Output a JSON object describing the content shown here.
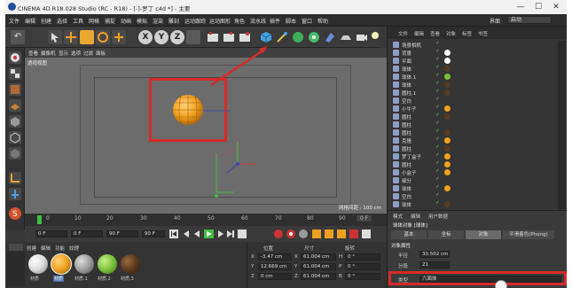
{
  "window": {
    "title": "CINEMA 4D R18.028 Studio (RC - R18) - [-]-罗丁 c4d *] - 主要",
    "controls": {
      "minimize": "—",
      "maximize": "☐",
      "close": "✕"
    }
  },
  "menubar": {
    "items": [
      "文件",
      "编辑",
      "创建",
      "选择",
      "工具",
      "网格",
      "捕捉",
      "动画",
      "模拟",
      "渲染",
      "雕刻",
      "运动跟踪",
      "运动图形",
      "角色",
      "流水线",
      "插件",
      "脚本",
      "窗口",
      "帮助"
    ],
    "layout_label": "界面",
    "layout_value": "启动"
  },
  "toolbar": {
    "axis_buttons": [
      "X",
      "Y",
      "Z"
    ]
  },
  "viewport": {
    "menu": [
      "查看",
      "摄像机",
      "显示",
      "选项",
      "过滤",
      "面板"
    ],
    "name": "透视视图",
    "grid_info": "网格间距 : 100 cm"
  },
  "timeline": {
    "ticks": [
      "0",
      "10",
      "20",
      "30",
      "40",
      "50",
      "60",
      "70",
      "80",
      "90"
    ],
    "end_label": "0 F"
  },
  "transport": {
    "current_frame": "0 F",
    "start_frame": "0 F",
    "end_frame": "90 F",
    "end_frame_2": "90 F"
  },
  "materials": {
    "menu": [
      "创建",
      "编辑",
      "功能",
      "纹理"
    ],
    "items": [
      {
        "label": "材质",
        "color": "#d9d9d9"
      },
      {
        "label": "材质",
        "color": "#f0a020"
      },
      {
        "label": "材质.1",
        "color": "#9c9c9c"
      },
      {
        "label": "材质.2",
        "color": "#7cc23a"
      },
      {
        "label": "材质.3",
        "color": "#5a3a1e"
      }
    ]
  },
  "coordinates": {
    "headers": [
      "位置",
      "尺寸",
      "旋转"
    ],
    "rows": [
      {
        "axis": "X",
        "pos": "-3.47 cm",
        "size_axis": "X",
        "size": "61.004 cm",
        "rot_axis": "H",
        "rot": "0 °"
      },
      {
        "axis": "Y",
        "pos": "12.669 cm",
        "size_axis": "Y",
        "size": "61.004 cm",
        "rot_axis": "P",
        "rot": "0 °"
      },
      {
        "axis": "Z",
        "pos": "0 cm",
        "size_axis": "Z",
        "size": "61.004 cm",
        "rot_axis": "B",
        "rot": "0 °"
      }
    ]
  },
  "object_manager": {
    "menu": [
      "文件",
      "编辑",
      "查看",
      "对象",
      "标签",
      "书签"
    ],
    "objects": [
      {
        "name": "场景相机",
        "swatch": ""
      },
      {
        "name": "背景",
        "swatch": "#ffffff"
      },
      {
        "name": "平面",
        "swatch": "#ffffff"
      },
      {
        "name": "球体",
        "swatch": "#5a3a1e"
      },
      {
        "name": "球体.1",
        "swatch": "#7cc23a"
      },
      {
        "name": "球体",
        "swatch": "#5a3a1e"
      },
      {
        "name": "圆柱.1",
        "swatch": "#5a3a1e"
      },
      {
        "name": "空白",
        "swatch": ""
      },
      {
        "name": "小牛子",
        "swatch": "#f0a020"
      },
      {
        "name": "圆柱",
        "swatch": "#5a3a1e"
      },
      {
        "name": "圆柱",
        "swatch": ""
      },
      {
        "name": "圆柱",
        "swatch": "#5a3a1e"
      },
      {
        "name": "克隆",
        "swatch": "#f0a020"
      },
      {
        "name": "圆柱",
        "swatch": "#5a3a1e"
      },
      {
        "name": "罗丁盒子",
        "swatch": "#f0a020"
      },
      {
        "name": "圆柱",
        "swatch": "#f0a020"
      },
      {
        "name": "小盒子",
        "swatch": "#f0a020"
      },
      {
        "name": "细分",
        "swatch": ""
      },
      {
        "name": "球体",
        "swatch": "#f0a020"
      },
      {
        "name": "空白",
        "swatch": ""
      },
      {
        "name": "球体",
        "swatch": "#5a3a1e"
      }
    ]
  },
  "attributes": {
    "menu": [
      "模式",
      "编辑",
      "用户数据"
    ],
    "object_title": "球体对象 [球体]",
    "tabs": [
      "基本",
      "坐标",
      "对象",
      "平滑着色(Phong)"
    ],
    "section": "对象属性",
    "fields": [
      {
        "label": "半径",
        "value": "30.502 cm"
      },
      {
        "label": "分段",
        "value": "21"
      },
      {
        "label": "类型",
        "value": "六面体"
      }
    ]
  },
  "colors": {
    "highlight": "#d62a2a",
    "sphere": "#f2a020",
    "panel": "#353535"
  }
}
